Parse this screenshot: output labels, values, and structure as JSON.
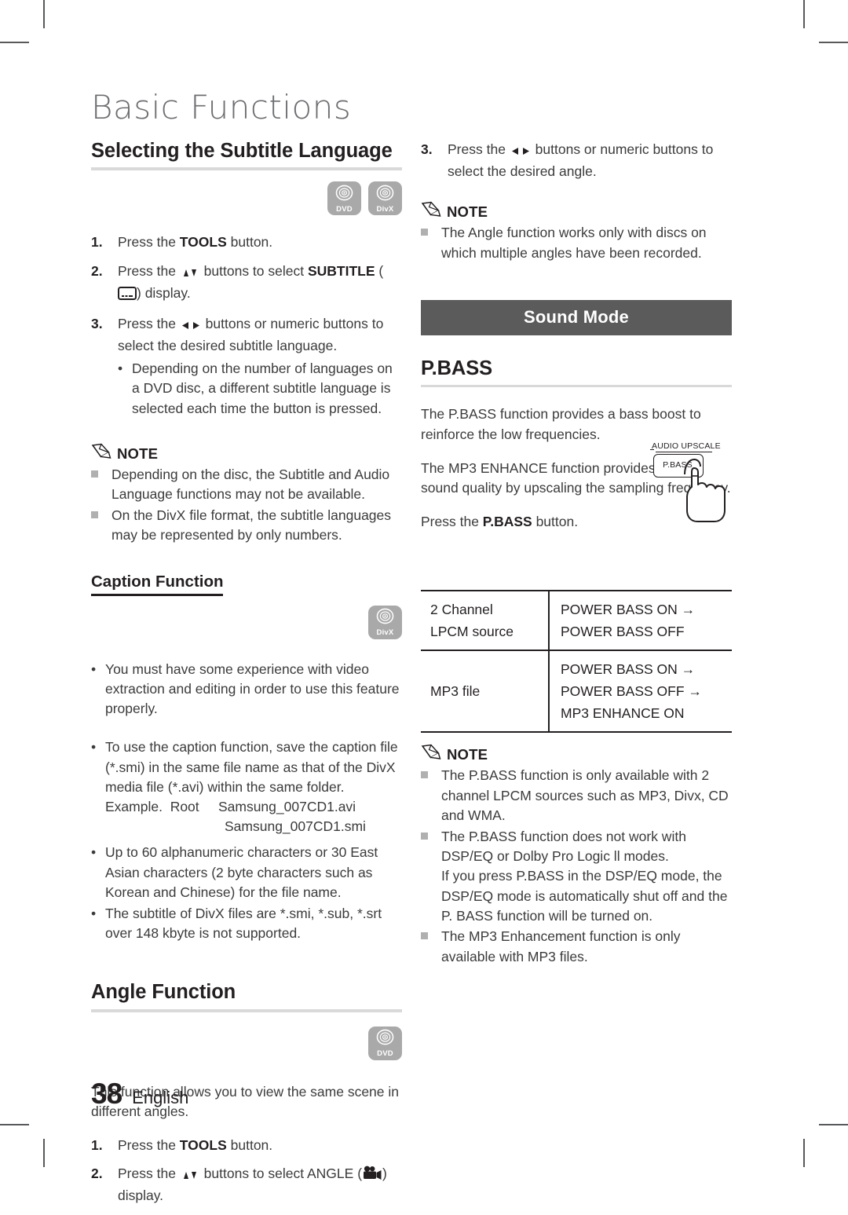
{
  "chapter": {
    "title": "Basic Functions"
  },
  "footer": {
    "page_number": "38",
    "language": "English"
  },
  "left_column": {
    "section_subtitle": {
      "heading": "Selecting the Subtitle Language",
      "badges": [
        {
          "icon": "disc-icon",
          "label": "DVD"
        },
        {
          "icon": "disc-icon",
          "label": "DivX"
        }
      ],
      "steps": [
        {
          "num": "1.",
          "pre": "Press the ",
          "bold": "TOOLS",
          "post": " button."
        },
        {
          "num": "2.",
          "pre": "Press the ",
          "mid": " buttons to select ",
          "bold": "SUBTITLE",
          "post": " display."
        },
        {
          "num": "3.",
          "pre": "Press the ",
          "post": " buttons or numeric buttons to select the desired subtitle language."
        }
      ],
      "step3_bullets": [
        "Depending on the number of languages on a DVD disc, a different subtitle language is selected each time the button is pressed."
      ],
      "note_label": "NOTE",
      "notes": [
        "Depending on the disc, the Subtitle and Audio Language functions may not be available.",
        "On the DivX file format, the subtitle languages may be represented by only numbers."
      ]
    },
    "section_caption": {
      "heading": "Caption Function",
      "badges": [
        {
          "icon": "disc-icon",
          "label": "DivX"
        }
      ],
      "bullets": [
        "You must have some experience with video extraction and editing in order to use this feature properly.",
        "To use the caption function, save the caption file (*.smi) in the same file name as that of the DivX media file (*.avi) within the same folder.",
        "Up to 60 alphanumeric characters or 30 East Asian characters (2 byte characters such as Korean and Chinese) for the file name.",
        "The subtitle of DivX files are *.smi, *.sub, *.srt over 148 kbyte is not supported."
      ],
      "example": {
        "label": "Example.",
        "root": "Root",
        "file1": "Samsung_007CD1.avi",
        "file2": "Samsung_007CD1.smi"
      }
    },
    "section_angle": {
      "heading": "Angle Function",
      "badges": [
        {
          "icon": "disc-icon",
          "label": "DVD"
        }
      ],
      "intro": "This function allows you to view the same scene in different angles.",
      "steps": [
        {
          "num": "1.",
          "pre": "Press the ",
          "bold": "TOOLS",
          "post": " button."
        },
        {
          "num": "2.",
          "pre": "Press the ",
          "mid": " buttons to select ",
          "plain": "ANGLE",
          "post": " display."
        }
      ]
    }
  },
  "right_column": {
    "angle_step3": {
      "num": "3.",
      "pre": "Press the ",
      "post": " buttons or numeric buttons to select the desired angle."
    },
    "angle_note_label": "NOTE",
    "angle_notes": [
      "The Angle function works only with discs on which multiple angles have been recorded."
    ],
    "sound_mode_bar": "Sound Mode",
    "pbass": {
      "heading": "P.BASS",
      "paragraph1": "The P.BASS function provides a bass boost to reinforce the low frequencies.",
      "paragraph2": "The MP3 ENHANCE function provides better sound quality by upscaling the sampling frequency.",
      "press_pre": "Press the ",
      "press_bold": "P.BASS",
      "press_post": " button."
    },
    "illustration": {
      "caption": "AUDIO UPSCALE",
      "button_label": "P.BASS",
      "hand_icon": "hand-pointing-icon"
    },
    "table": {
      "rows": [
        {
          "source": "2 Channel\nLPCM source",
          "source_line1": "2 Channel",
          "source_line2": "LPCM source",
          "modes": [
            "POWER BASS ON  →",
            "POWER BASS OFF"
          ]
        },
        {
          "source_line1": "MP3 file",
          "source_line2": "",
          "modes": [
            "POWER BASS ON  →",
            "POWER BASS OFF  →",
            "MP3 ENHANCE ON"
          ]
        }
      ]
    },
    "note_label": "NOTE",
    "notes": [
      "The P.BASS function is only available with 2 channel LPCM sources such as MP3, Divx, CD and WMA.",
      "The P.BASS function does not work with DSP/EQ or Dolby Pro Logic ll modes.\nIf you press P.BASS in the DSP/EQ mode, the DSP/EQ mode is automatically shut off and the P. BASS function will be turned on.",
      "The MP3 Enhancement function is only available with MP3 files."
    ]
  },
  "colors": {
    "chapter_gray": "#6d6e71",
    "rule_gray": "#d9d9d9",
    "bar_dark": "#5b5b5b",
    "badge_gray": "#a9a9a9",
    "text": "#231f20"
  }
}
